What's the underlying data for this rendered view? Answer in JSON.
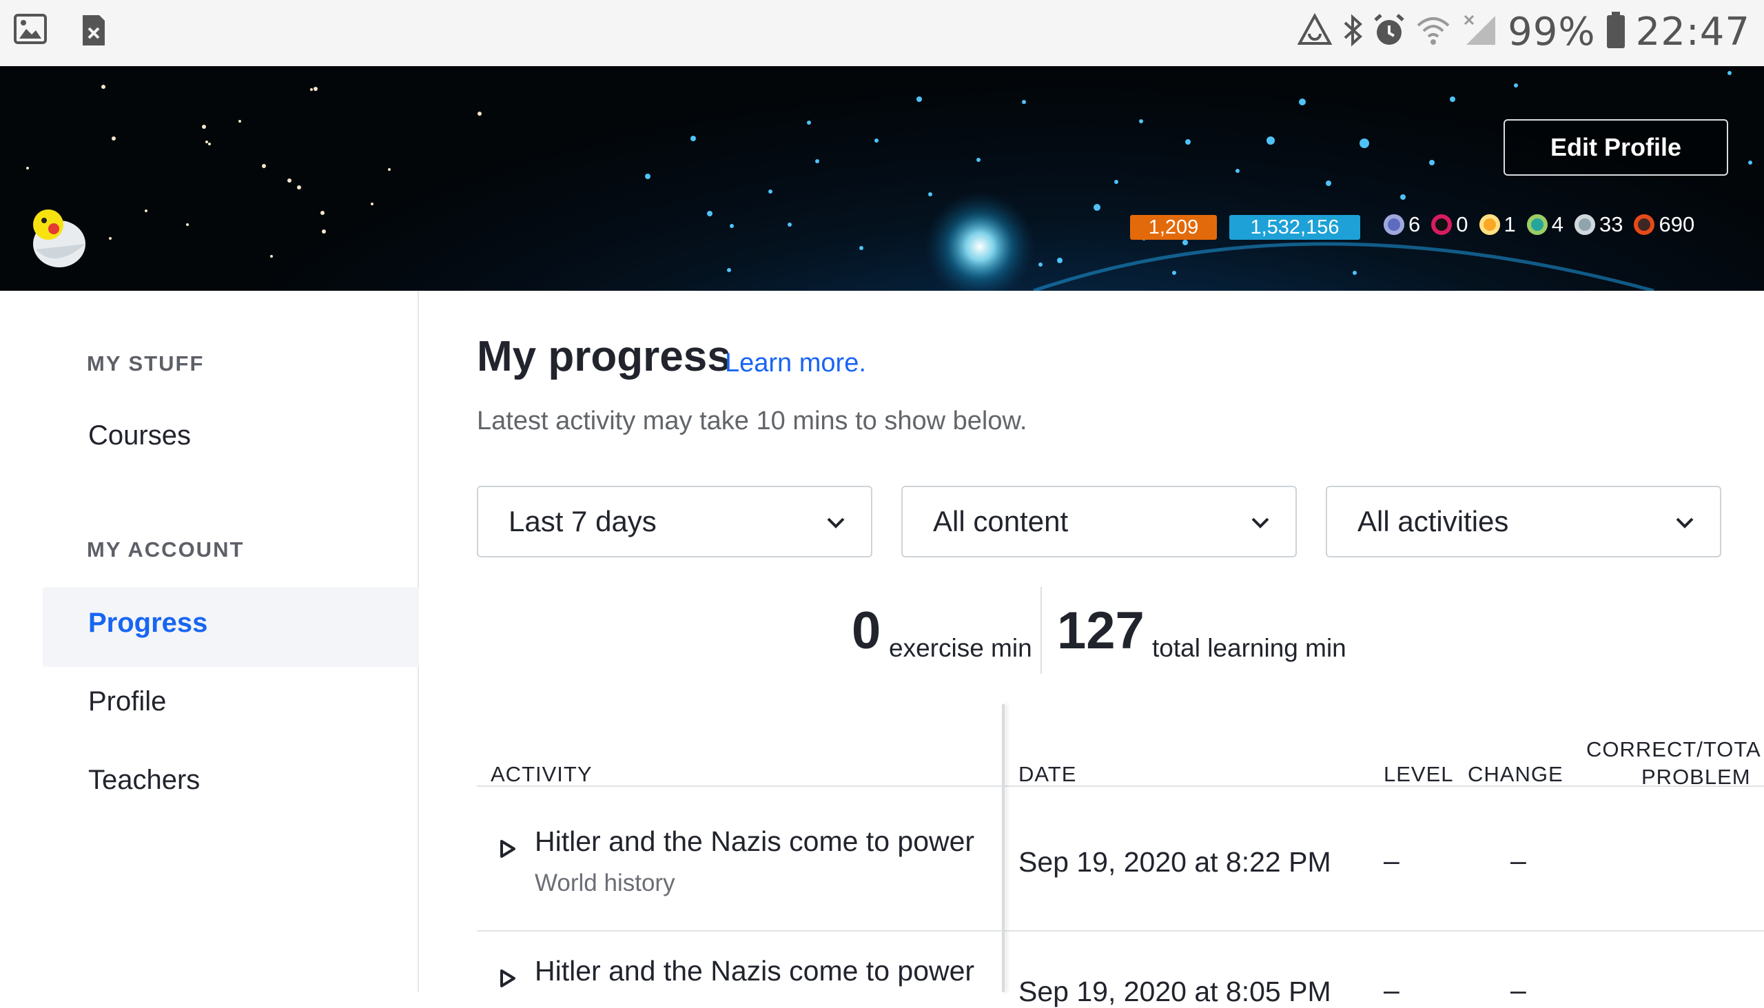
{
  "statusbar": {
    "battery_text": "99%",
    "time": "22:47"
  },
  "banner": {
    "edit_profile_label": "Edit Profile",
    "energy_points": "1,209",
    "total_points": "1,532,156",
    "badges": [
      {
        "icon": "meteorite-badge-icon",
        "count": "6",
        "color": "#6c7fd8"
      },
      {
        "icon": "moon-badge-icon",
        "count": "0",
        "color": "#d81b60"
      },
      {
        "icon": "earth-badge-icon",
        "count": "1",
        "color": "#f4c20d"
      },
      {
        "icon": "sun-badge-icon",
        "count": "4",
        "color": "#4caf50"
      },
      {
        "icon": "black-hole-badge-icon",
        "count": "33",
        "color": "#b0bec5"
      },
      {
        "icon": "challenge-patch-icon",
        "count": "690",
        "color": "#e64a19"
      }
    ]
  },
  "sidebar": {
    "my_stuff_heading": "MY STUFF",
    "courses_label": "Courses",
    "my_account_heading": "MY ACCOUNT",
    "items": [
      {
        "label": "Progress",
        "active": true
      },
      {
        "label": "Profile",
        "active": false
      },
      {
        "label": "Teachers",
        "active": false
      }
    ]
  },
  "main": {
    "title": "My progress",
    "learn_more": "Learn more.",
    "subtitle": "Latest activity may take 10 mins to show below.",
    "filters": {
      "time": "Last 7 days",
      "content": "All content",
      "activities": "All activities"
    },
    "stats": {
      "exercise_value": "0",
      "exercise_label": "exercise min",
      "total_value": "127",
      "total_label": "total learning min"
    },
    "table": {
      "headers": {
        "activity": "ACTIVITY",
        "date": "DATE",
        "level": "LEVEL",
        "change": "CHANGE",
        "correct_line1": "CORRECT/TOTA",
        "correct_line2": "PROBLEM"
      },
      "rows": [
        {
          "title": "Hitler and the Nazis come to power",
          "subtitle": "World history",
          "date": "Sep 19, 2020 at 8:22 PM",
          "level": "–",
          "change": "–"
        },
        {
          "title": "Hitler and the Nazis come to power",
          "subtitle": "",
          "date": "Sep 19, 2020 at 8:05 PM",
          "level": "–",
          "change": "–"
        }
      ]
    }
  }
}
